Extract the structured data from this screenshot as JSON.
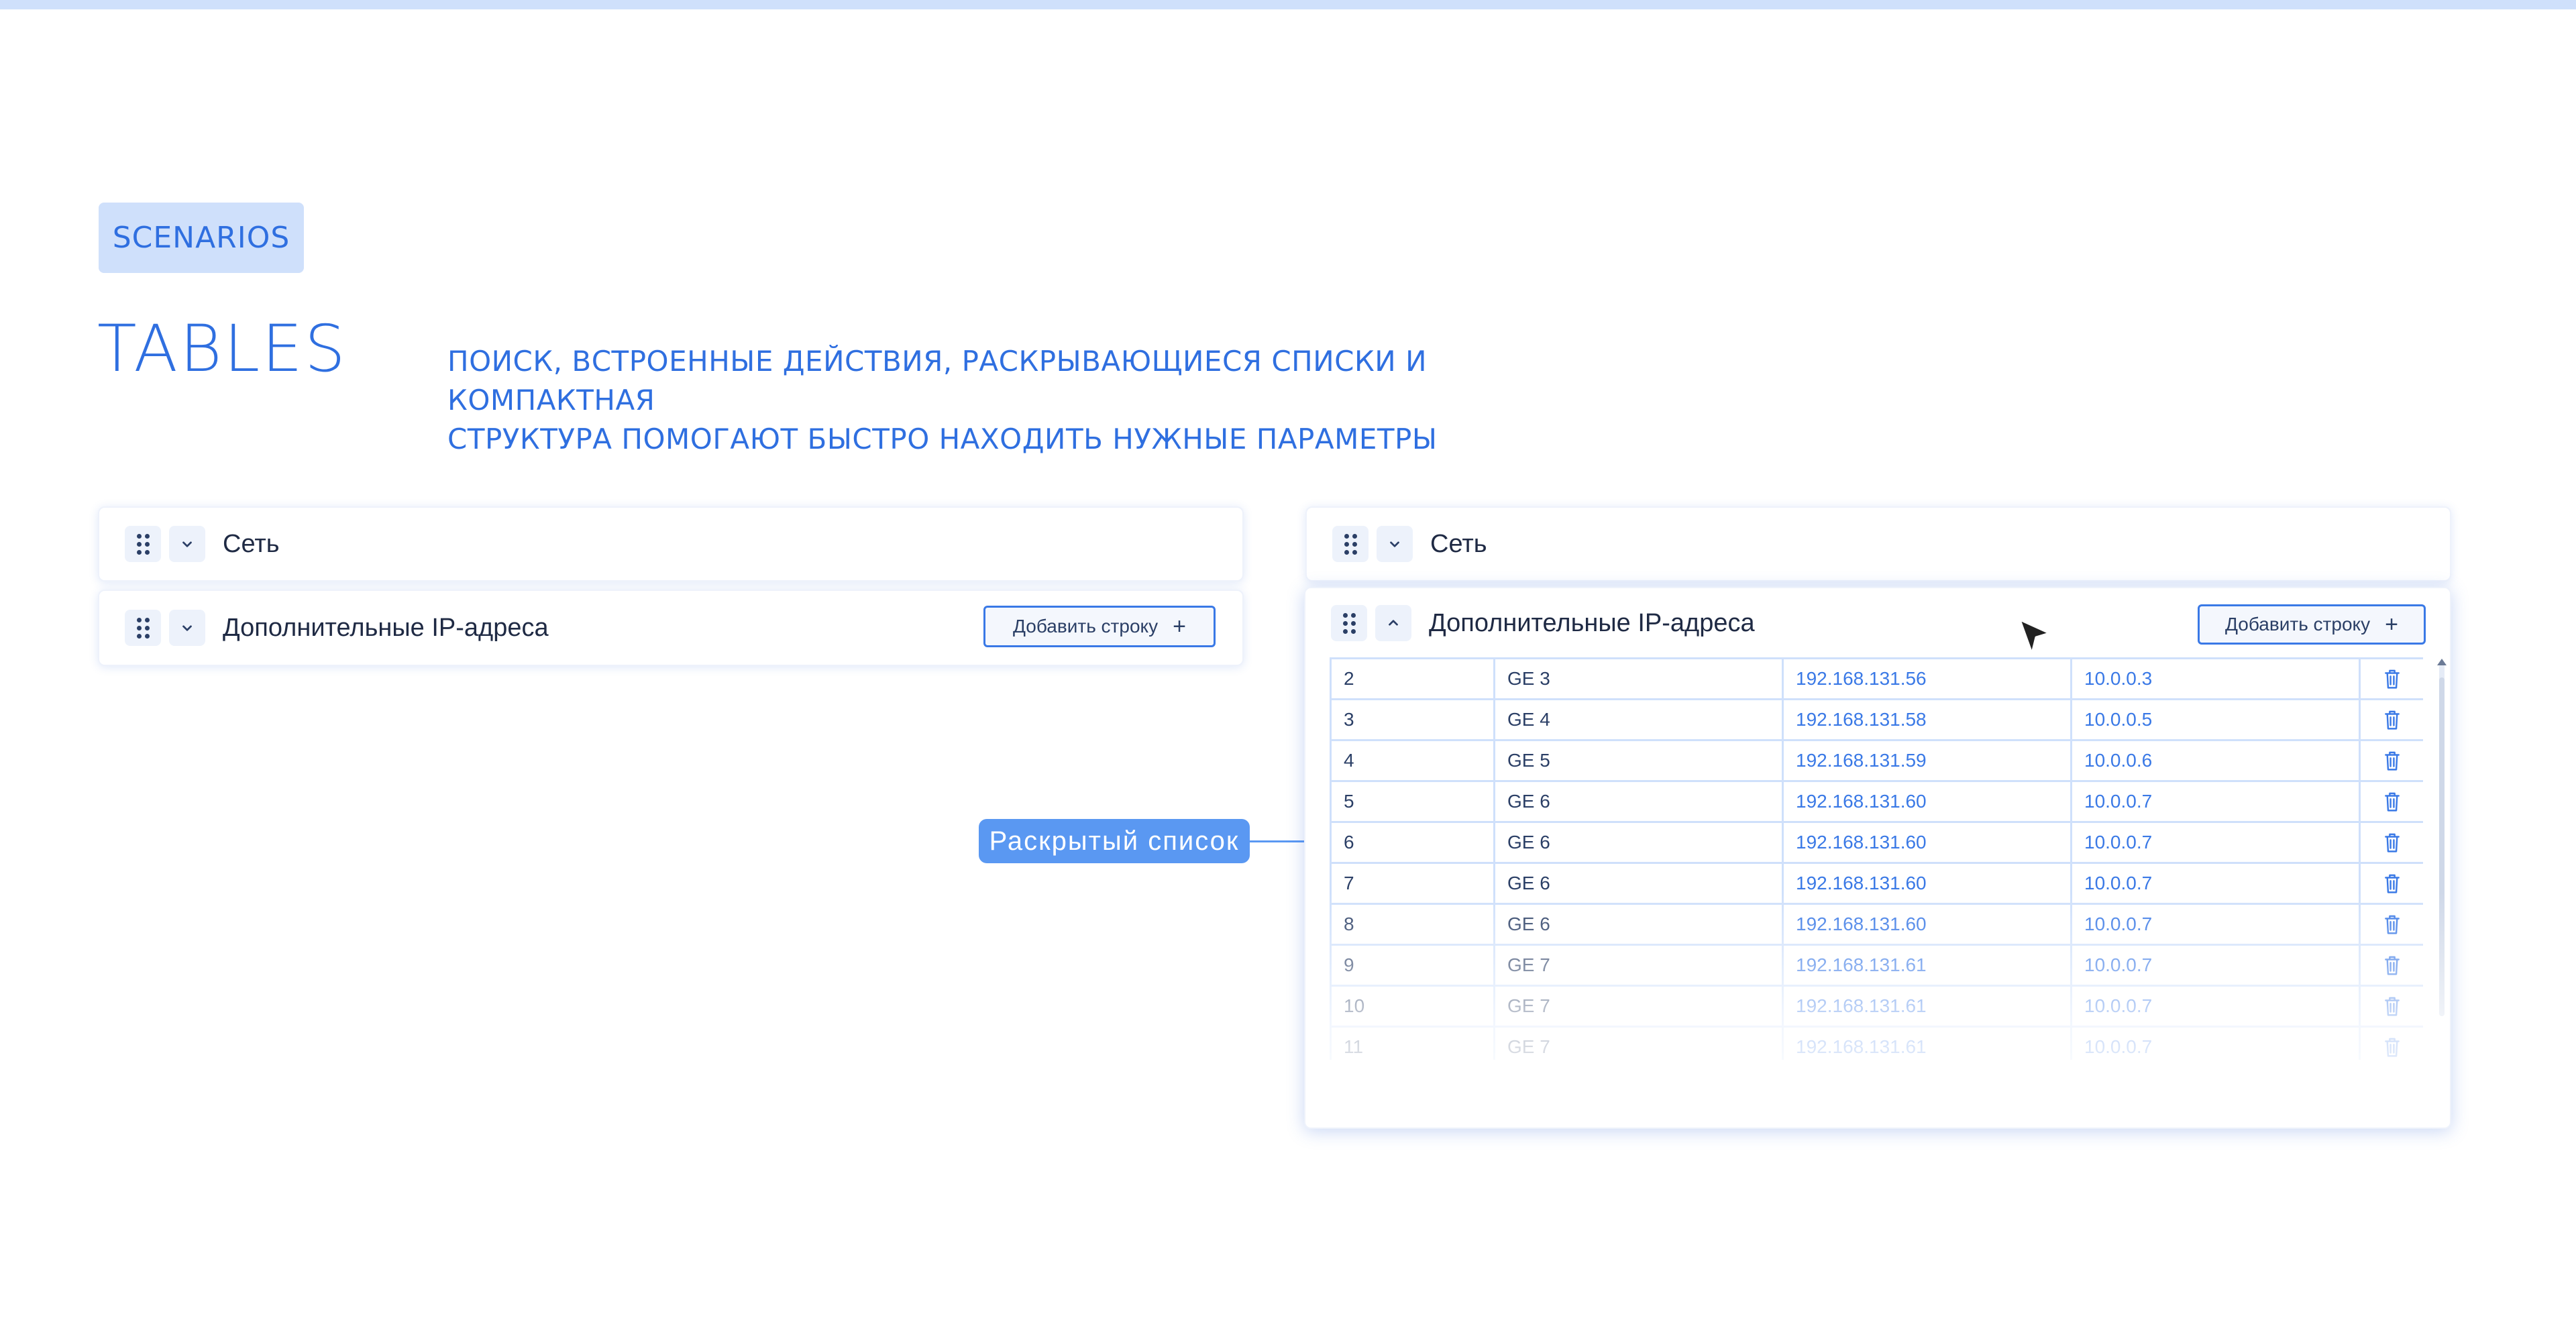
{
  "badge": "SCENARIOS",
  "title": "TABLES",
  "subtitle": {
    "line1": "ПОИСК, ВСТРОЕННЫЕ ДЕЙСТВИЯ, РАСКРЫВАЮЩИЕСЯ СПИСКИ И КОМПАКТНАЯ",
    "line2": "СТРУКТУРА ПОМОГАЮТ БЫСТРО НАХОДИТЬ НУЖНЫЕ ПАРАМЕТРЫ"
  },
  "left_panel": {
    "network": {
      "title": "Сеть",
      "icon": "chevron-down-icon"
    },
    "extra_ip": {
      "title": "Дополнительные IP-адреса",
      "add_button": "Добавить строку",
      "add_icon": "+",
      "icon": "chevron-down-icon"
    }
  },
  "right_panel": {
    "network": {
      "title": "Сеть",
      "icon": "chevron-down-icon"
    },
    "extra_ip": {
      "title": "Дополнительные IP-адреса",
      "add_button": "Добавить строку",
      "add_icon": "+",
      "icon": "chevron-up-icon"
    },
    "rows": [
      {
        "num": "2",
        "port": "GE 3",
        "ip": "192.168.131.56",
        "gw": "10.0.0.3"
      },
      {
        "num": "3",
        "port": "GE 4",
        "ip": "192.168.131.58",
        "gw": "10.0.0.5"
      },
      {
        "num": "4",
        "port": "GE 5",
        "ip": "192.168.131.59",
        "gw": "10.0.0.6"
      },
      {
        "num": "5",
        "port": "GE 6",
        "ip": "192.168.131.60",
        "gw": "10.0.0.7"
      },
      {
        "num": "6",
        "port": "GE 6",
        "ip": "192.168.131.60",
        "gw": "10.0.0.7"
      },
      {
        "num": "7",
        "port": "GE 6",
        "ip": "192.168.131.60",
        "gw": "10.0.0.7"
      },
      {
        "num": "8",
        "port": "GE 6",
        "ip": "192.168.131.60",
        "gw": "10.0.0.7"
      },
      {
        "num": "9",
        "port": "GE 7",
        "ip": "192.168.131.61",
        "gw": "10.0.0.7"
      },
      {
        "num": "10",
        "port": "GE 7",
        "ip": "192.168.131.61",
        "gw": "10.0.0.7"
      },
      {
        "num": "11",
        "port": "GE 7",
        "ip": "192.168.131.61",
        "gw": "10.0.0.7"
      }
    ]
  },
  "callout": "Раскрытый  список",
  "colors": {
    "accent": "#2f6fe0",
    "badge_bg": "#cfe0fb",
    "callout_bg": "#5a98f2",
    "link": "#3a79e6"
  }
}
